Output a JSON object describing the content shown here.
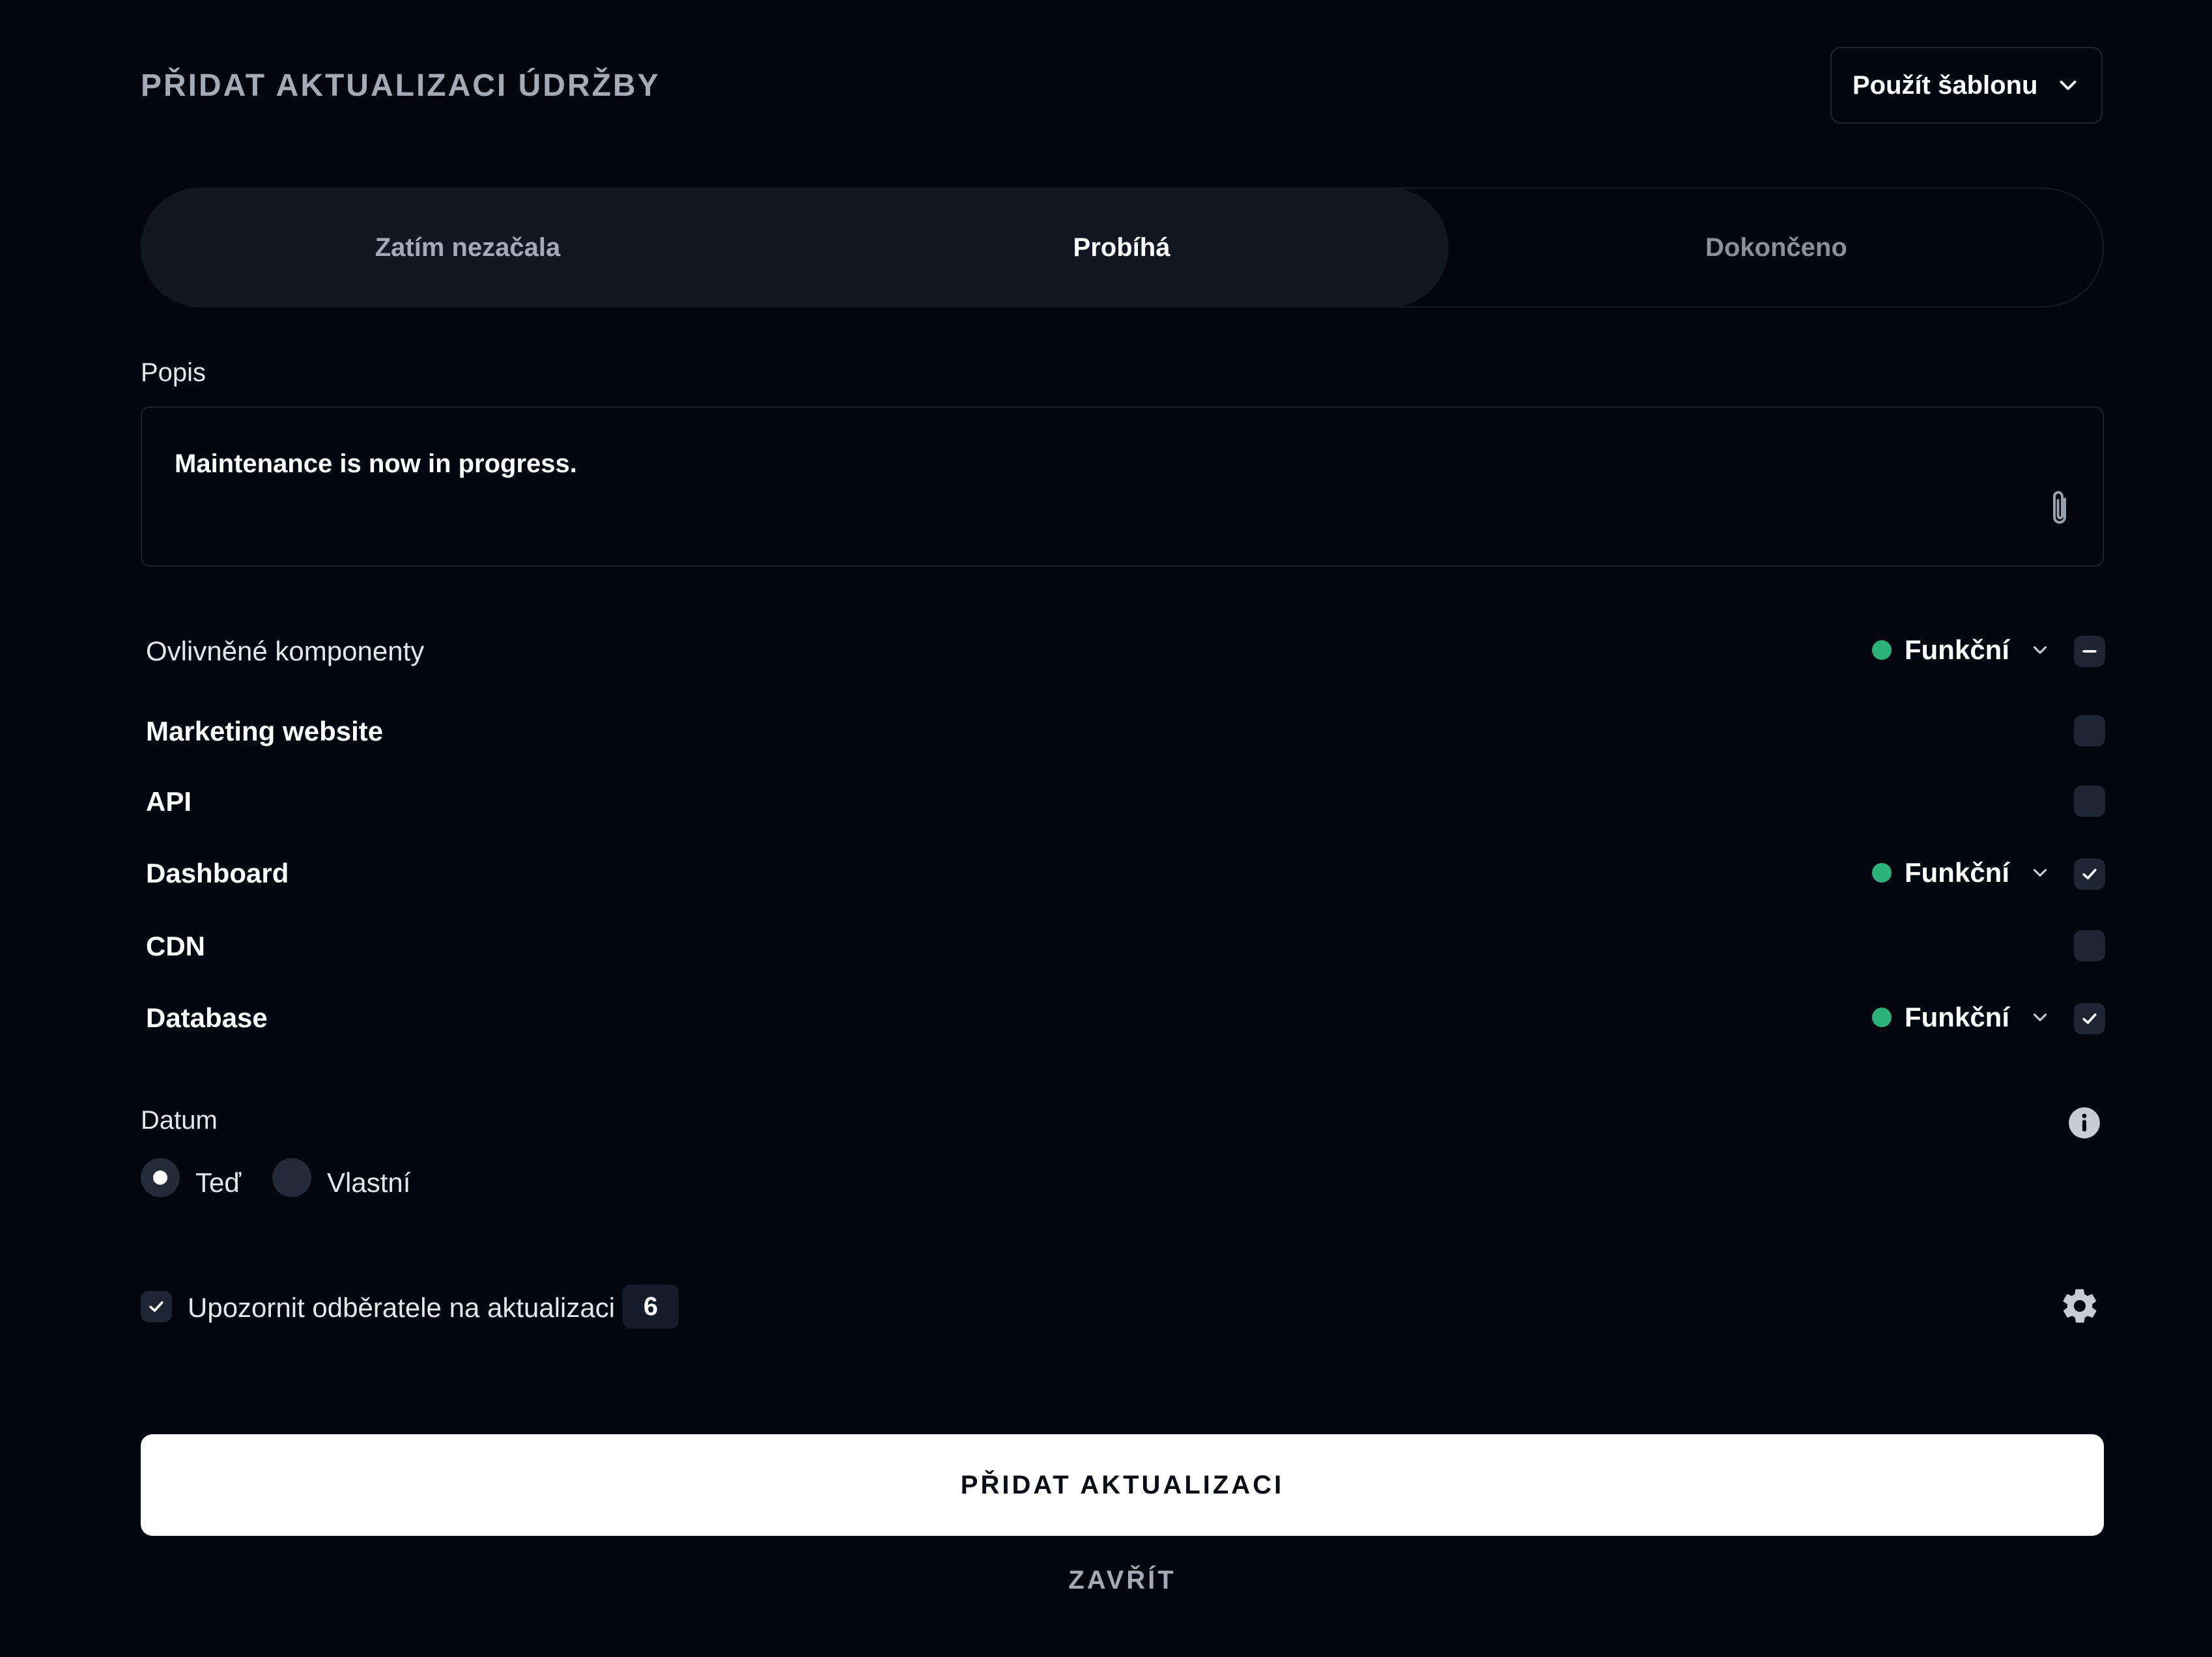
{
  "header": {
    "title": "PŘIDAT AKTUALIZACI ÚDRŽBY",
    "template_button": "Použít šablonu"
  },
  "status_tabs": [
    {
      "label": "Zatím nezačala",
      "active": false
    },
    {
      "label": "Probíhá",
      "active": true
    },
    {
      "label": "Dokončeno",
      "active": false
    }
  ],
  "description": {
    "label": "Popis",
    "value": "Maintenance is now in progress."
  },
  "components": {
    "header_label": "Ovlivněné komponenty",
    "header_status": "Funkční",
    "items": [
      {
        "name": "Marketing website",
        "checked": false,
        "status": ""
      },
      {
        "name": "API",
        "checked": false,
        "status": ""
      },
      {
        "name": "Dashboard",
        "checked": true,
        "status": "Funkční"
      },
      {
        "name": "CDN",
        "checked": false,
        "status": ""
      },
      {
        "name": "Database",
        "checked": true,
        "status": "Funkční"
      }
    ]
  },
  "date": {
    "label": "Datum",
    "options": [
      {
        "label": "Teď",
        "selected": true
      },
      {
        "label": "Vlastní",
        "selected": false
      }
    ]
  },
  "notify": {
    "label": "Upozornit odběratele na aktualizaci",
    "count": "6",
    "checked": true
  },
  "actions": {
    "submit": "PŘIDAT AKTUALIZACI",
    "close": "ZAVŘÍT"
  },
  "colors": {
    "background": "#04060f",
    "status_ok": "#2bb37a",
    "primary_button": "#ffffff"
  }
}
